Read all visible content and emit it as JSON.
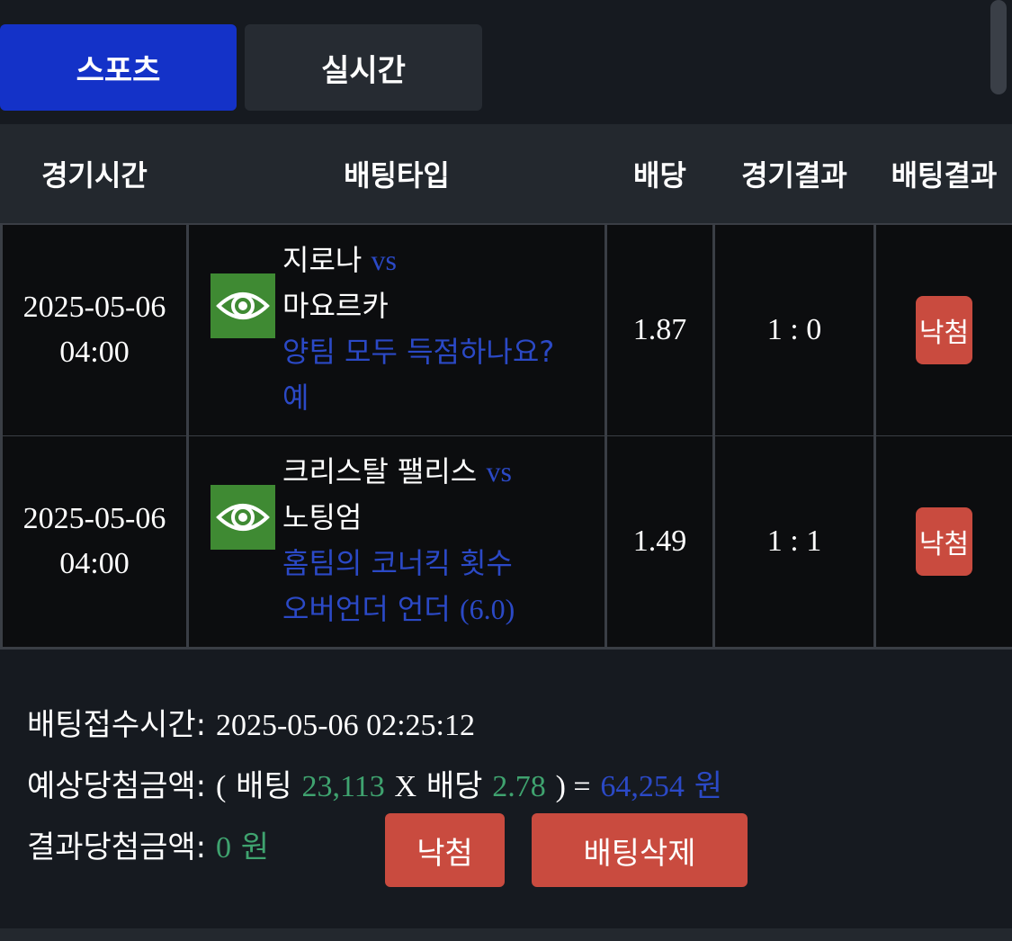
{
  "tabs": [
    {
      "label": "스포츠",
      "active": true
    },
    {
      "label": "실시간",
      "active": false
    }
  ],
  "columns": [
    "경기시간",
    "배팅타입",
    "배당",
    "경기결과",
    "배팅결과"
  ],
  "bets": [
    {
      "date": "2025-05-06",
      "time": "04:00",
      "home": "지로나",
      "vs": "vs",
      "away": "마요르카",
      "market": "양팀 모두 득점하나요?",
      "pick": "예",
      "odds": "1.87",
      "score": "1 : 0",
      "result": "낙첨"
    },
    {
      "date": "2025-05-06",
      "time": "04:00",
      "home": "크리스탈 팰리스",
      "vs": "vs",
      "away": "노팅엄",
      "market": "홈팀의 코너킥 횟수",
      "pick_text": "오버언더 언더 ",
      "pick_num": "(6.0)",
      "odds": "1.49",
      "score": "1 : 1",
      "result": "낙첨"
    }
  ],
  "summary": {
    "bet_time_label": "배팅접수시간:",
    "bet_time_value": "2025-05-06 02:25:12",
    "expected_label": "예상당첨금액:",
    "open_paren": "(",
    "bet_word": "배팅",
    "bet_amount": "23,113",
    "x": "X",
    "odds_word": "배당",
    "total_odds": "2.78",
    "close_paren_eq": ") =",
    "expected_amount": "64,254",
    "won": "원",
    "result_label": "결과당첨금액:",
    "result_amount": "0",
    "result_won": "원",
    "lose_button": "낙첨",
    "delete_button": "배팅삭제"
  },
  "colors": {
    "active_tab": "#1432c8",
    "inactive_tab": "#262b32",
    "eye_button": "#3f8a33",
    "lose_badge": "#c94b3f",
    "blue_text": "#2b49c6",
    "green_text": "#3fa36f"
  },
  "icons": {
    "detail": "eye-icon"
  }
}
